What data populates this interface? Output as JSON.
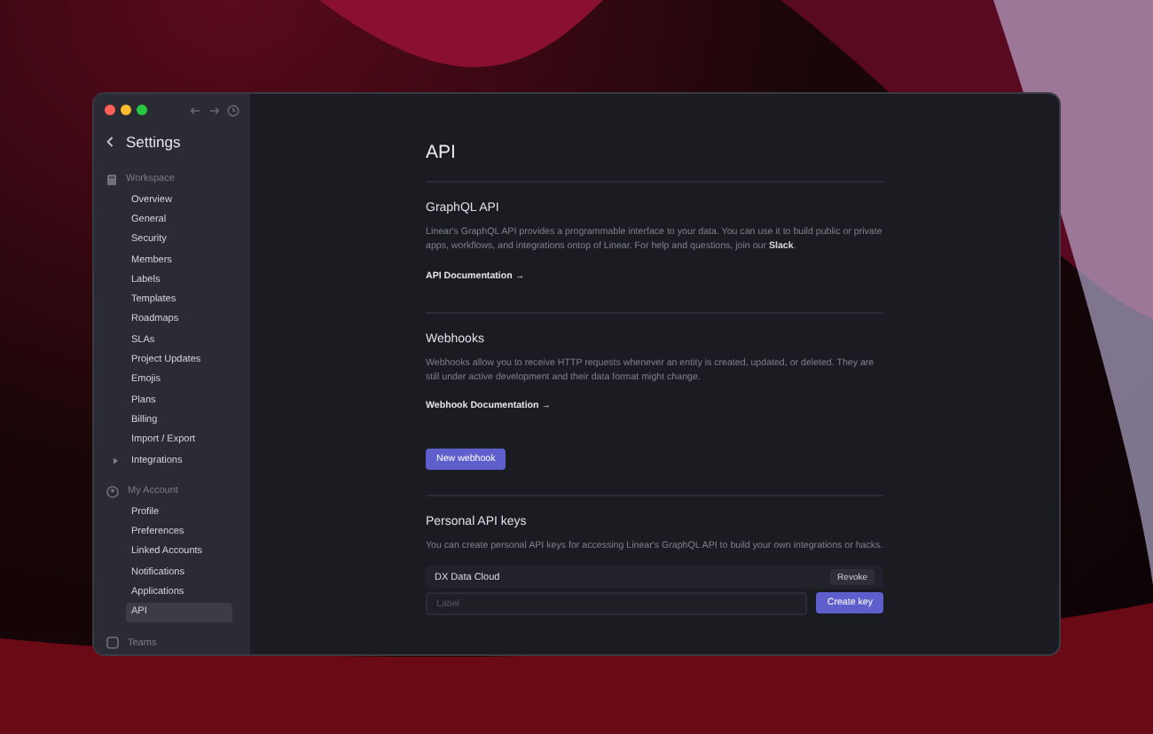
{
  "sidebar": {
    "title": "Settings",
    "groups": [
      {
        "label": "Workspace",
        "kind": "building",
        "items": [
          {
            "label": "Overview",
            "selected": false
          },
          {
            "label": "General",
            "selected": false
          },
          {
            "label": "Security",
            "selected": false
          },
          {
            "label": "Members",
            "selected": false
          },
          {
            "label": "Labels",
            "selected": false
          },
          {
            "label": "Templates",
            "selected": false
          },
          {
            "label": "Roadmaps",
            "selected": false
          },
          {
            "label": "SLAs",
            "selected": false
          },
          {
            "label": "Project Updates",
            "selected": false
          },
          {
            "label": "Emojis",
            "selected": false
          },
          {
            "label": "Plans",
            "selected": false
          },
          {
            "label": "Billing",
            "selected": false
          },
          {
            "label": "Import / Export",
            "selected": false
          },
          {
            "label": "Integrations",
            "selected": false,
            "expanded": false
          }
        ]
      },
      {
        "label": "My Account",
        "kind": "user",
        "items": [
          {
            "label": "Profile",
            "selected": false
          },
          {
            "label": "Preferences",
            "selected": false
          },
          {
            "label": "Linked Accounts",
            "selected": false
          },
          {
            "label": "Notifications",
            "selected": false
          },
          {
            "label": "Applications",
            "selected": false
          },
          {
            "label": "API",
            "selected": true
          }
        ]
      },
      {
        "label": "Teams",
        "kind": "team"
      }
    ]
  },
  "page": {
    "title": "API",
    "sections": [
      {
        "title": "GraphQL API",
        "text": "Linear's GraphQL API provides a programmable interface to your data. You can use it to build public or private apps, workflows, and integrations ontop of Linear. For help and questions, join our **Slack**.",
        "link": "API Documentation →"
      },
      {
        "title": "Webhooks",
        "text": "Webhooks allow you to receive HTTP requests whenever an entity is created, updated, or deleted. They are still under active development and their data format might change.",
        "link": "Webhook Documentation →",
        "button": "New webhook"
      },
      {
        "title": "Personal API keys",
        "text": "You can create personal API keys for accessing Linear's GraphQL API to build your own integrations or hacks.",
        "keys": [
          {
            "name": "DX Data Cloud",
            "action": "Revoke"
          }
        ],
        "input": {
          "placeholder": "Label"
        },
        "submit": "Create key"
      }
    ]
  }
}
